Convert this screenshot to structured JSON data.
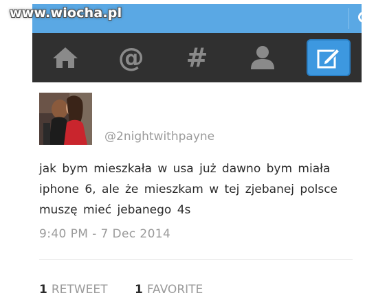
{
  "watermark": {
    "text": "www.wiocha.pl"
  },
  "colors": {
    "topbar": "#5aa8e4",
    "navbar": "#303030",
    "accent": "#3d98e0",
    "muted_text": "#9a9a9a"
  },
  "topbar": {
    "search_icon": "search-icon"
  },
  "nav": {
    "items": [
      {
        "name": "home",
        "icon": "home-icon"
      },
      {
        "name": "mentions",
        "icon": "at-sign-icon",
        "glyph": "@"
      },
      {
        "name": "discover",
        "icon": "hashtag-icon",
        "glyph": "#"
      },
      {
        "name": "profile",
        "icon": "person-icon"
      },
      {
        "name": "compose",
        "icon": "compose-icon",
        "active": true
      }
    ]
  },
  "tweet": {
    "handle": "@2nightwithpayne",
    "lines": [
      "jak bym  mieszkała  w usa już dawno  bym  miała",
      "iphone  6,  ale że mieszkam  w tej zjebanej polsce",
      "muszę  mieć  jebanego  4s"
    ],
    "timestamp": "9:40  PM  - 7 Dec 2014"
  },
  "stats": {
    "retweets": {
      "count": "1",
      "label": "RETWEET"
    },
    "favorites": {
      "count": "1",
      "label": "FAVORITE"
    }
  }
}
